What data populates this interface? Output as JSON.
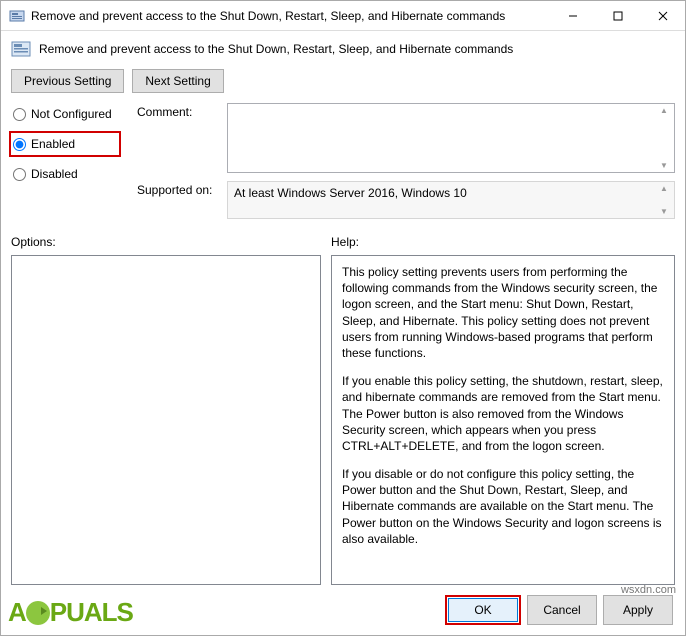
{
  "window": {
    "title": "Remove and prevent access to the Shut Down, Restart, Sleep, and Hibernate commands"
  },
  "header": {
    "subtitle": "Remove and prevent access to the Shut Down, Restart, Sleep, and Hibernate commands"
  },
  "nav": {
    "previous": "Previous Setting",
    "next": "Next Setting"
  },
  "radios": {
    "not_configured": "Not Configured",
    "enabled": "Enabled",
    "disabled": "Disabled",
    "selected": "enabled"
  },
  "form": {
    "comment_label": "Comment:",
    "comment_value": "",
    "supported_label": "Supported on:",
    "supported_value": "At least Windows Server 2016, Windows 10"
  },
  "lower": {
    "options_label": "Options:",
    "help_label": "Help:",
    "help_p1": "This policy setting prevents users from performing the following commands from the Windows security screen, the logon screen, and the Start menu: Shut Down, Restart, Sleep, and Hibernate. This policy setting does not prevent users from running Windows-based programs that perform these functions.",
    "help_p2": "If you enable this policy setting, the shutdown, restart, sleep, and hibernate commands are removed from the Start menu. The Power button is also removed from the Windows Security screen, which appears when you press CTRL+ALT+DELETE, and from the logon screen.",
    "help_p3": "If you disable or do not configure this policy setting, the Power button and the Shut Down, Restart, Sleep, and Hibernate commands are available on the Start menu. The Power button on the Windows Security and logon screens is also available."
  },
  "footer": {
    "ok": "OK",
    "cancel": "Cancel",
    "apply": "Apply"
  },
  "watermark": {
    "brand_pre": "A",
    "brand_post": "PUALS",
    "url": "wsxdn.com"
  }
}
